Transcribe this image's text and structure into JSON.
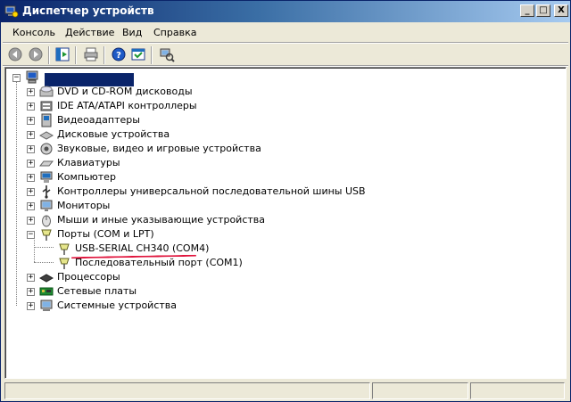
{
  "window": {
    "title": "Диспетчер устройств",
    "controls": {
      "minimize": "_",
      "maximize": "□",
      "close": "X"
    }
  },
  "menu": {
    "items": [
      {
        "label": "Консоль"
      },
      {
        "label": "Действие"
      },
      {
        "label": "Вид"
      },
      {
        "label": "Справка"
      }
    ]
  },
  "toolbar": {
    "buttons": [
      "back-icon",
      "forward-icon",
      "show-hide-tree-icon",
      "print-icon",
      "help-icon",
      "properties-icon",
      "scan-hardware-icon"
    ]
  },
  "tree": {
    "root": {
      "label": "",
      "expander": "−",
      "icon": "computer-icon"
    },
    "categories": [
      {
        "label": "DVD и CD-ROM дисководы",
        "icon": "dvd-drive-icon",
        "expander": "+"
      },
      {
        "label": "IDE ATA/ATAPI контроллеры",
        "icon": "ide-controller-icon",
        "expander": "+"
      },
      {
        "label": "Видеоадаптеры",
        "icon": "display-adapter-icon",
        "expander": "+"
      },
      {
        "label": "Дисковые устройства",
        "icon": "disk-drive-icon",
        "expander": "+"
      },
      {
        "label": "Звуковые, видео и игровые устройства",
        "icon": "sound-device-icon",
        "expander": "+"
      },
      {
        "label": "Клавиатуры",
        "icon": "keyboard-icon",
        "expander": "+"
      },
      {
        "label": "Компьютер",
        "icon": "computer-category-icon",
        "expander": "+"
      },
      {
        "label": "Контроллеры универсальной последовательной шины USB",
        "icon": "usb-icon",
        "expander": "+"
      },
      {
        "label": "Мониторы",
        "icon": "monitor-icon",
        "expander": "+"
      },
      {
        "label": "Мыши и иные указывающие устройства",
        "icon": "mouse-icon",
        "expander": "+"
      },
      {
        "label": "Порты (COM и LPT)",
        "icon": "port-icon",
        "expander": "−",
        "children": [
          {
            "label": "USB-SERIAL CH340 (COM4)",
            "icon": "port-device-icon",
            "highlighted": true
          },
          {
            "label": "Последовательный порт (COM1)",
            "icon": "port-device-icon"
          }
        ]
      },
      {
        "label": "Процессоры",
        "icon": "processor-icon",
        "expander": "+"
      },
      {
        "label": "Сетевые платы",
        "icon": "network-adapter-icon",
        "expander": "+"
      },
      {
        "label": "Системные устройства",
        "icon": "system-device-icon",
        "expander": "+"
      }
    ]
  },
  "colors": {
    "title_gradient_start": "#0a246a",
    "title_gradient_end": "#a6caf0",
    "annotation_underline": "#e0143c",
    "window_face": "#ece9d8"
  }
}
